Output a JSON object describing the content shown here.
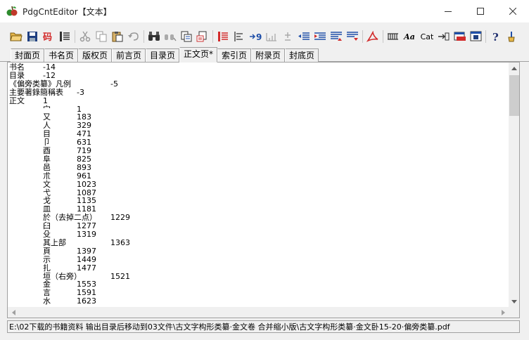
{
  "window": {
    "title": "PdgCntEditor【文本】",
    "controls": {
      "minimize": "minimize",
      "maximize": "maximize",
      "close": "close"
    }
  },
  "toolbar": {
    "font_label": "Aa",
    "cat_label": "Cat",
    "icons": [
      "open-folder-icon",
      "save-icon",
      "encoding-icon",
      "page-list-icon",
      "cut-icon",
      "copy-icon",
      "paste-icon",
      "undo-icon",
      "find-icon",
      "replace-icon",
      "page-copy-icon",
      "page-paste-icon",
      "indent-list-icon",
      "align-left-icon",
      "level-down-icon",
      "level-up-icon",
      "plus-minus-icon",
      "outdent-icon",
      "indent-icon",
      "move-up-icon",
      "move-down-icon",
      "pdf-icon",
      "columns-icon",
      "font-icon",
      "cat-icon",
      "bookmark-icon",
      "window-icon",
      "save-window-icon",
      "help-icon",
      "tools-icon"
    ]
  },
  "tabs": [
    {
      "label": "封面页",
      "active": false
    },
    {
      "label": "书名页",
      "active": false
    },
    {
      "label": "版权页",
      "active": false
    },
    {
      "label": "前言页",
      "active": false
    },
    {
      "label": "目录页",
      "active": false
    },
    {
      "label": "正文页*",
      "active": true
    },
    {
      "label": "索引页",
      "active": false
    },
    {
      "label": "附录页",
      "active": false
    },
    {
      "label": "封底页",
      "active": false
    }
  ],
  "editor": {
    "lines": [
      {
        "indent": 0,
        "title": "书名",
        "page": "-14"
      },
      {
        "indent": 0,
        "title": "目录",
        "page": "-12"
      },
      {
        "indent": 0,
        "title": "《偏旁类纂》凡例",
        "page": "-5"
      },
      {
        "indent": 0,
        "title": "主要著錄簡稱表",
        "page": "-3"
      },
      {
        "indent": 0,
        "title": "正文",
        "page": "1"
      },
      {
        "indent": 1,
        "title": "宀",
        "page": "1"
      },
      {
        "indent": 1,
        "title": "又",
        "page": "183"
      },
      {
        "indent": 1,
        "title": "人",
        "page": "329"
      },
      {
        "indent": 1,
        "title": "目",
        "page": "471"
      },
      {
        "indent": 1,
        "title": "卩",
        "page": "631"
      },
      {
        "indent": 1,
        "title": "酉",
        "page": "719"
      },
      {
        "indent": 1,
        "title": "阜",
        "page": "825"
      },
      {
        "indent": 1,
        "title": "邑",
        "page": "893"
      },
      {
        "indent": 1,
        "title": "朮",
        "page": "961"
      },
      {
        "indent": 1,
        "title": "文",
        "page": "1023"
      },
      {
        "indent": 1,
        "title": "弋",
        "page": "1087"
      },
      {
        "indent": 1,
        "title": "戈",
        "page": "1135"
      },
      {
        "indent": 1,
        "title": "皿",
        "page": "1181"
      },
      {
        "indent": 1,
        "title": "於（去掉二点）",
        "page": "1229"
      },
      {
        "indent": 1,
        "title": "臼",
        "page": "1277"
      },
      {
        "indent": 1,
        "title": "殳",
        "page": "1319"
      },
      {
        "indent": 1,
        "title": "其上部",
        "page": "1363"
      },
      {
        "indent": 1,
        "title": "頁",
        "page": "1397"
      },
      {
        "indent": 1,
        "title": "示",
        "page": "1449"
      },
      {
        "indent": 1,
        "title": "扎",
        "page": "1477"
      },
      {
        "indent": 1,
        "title": "垣（右旁）",
        "page": "1521"
      },
      {
        "indent": 1,
        "title": "金",
        "page": "1553"
      },
      {
        "indent": 1,
        "title": "言",
        "page": "1591"
      },
      {
        "indent": 1,
        "title": "水",
        "page": "1623"
      }
    ]
  },
  "status": {
    "path": "E:\\02下载的书籍资料  输出目录后移动到03文件\\古文字构形类纂·金文卷 合并缩小版\\古文字构形类纂·金文卧15-20·偏旁类纂.pdf"
  },
  "colors": {
    "toolbar_red": "#d22a2a",
    "toolbar_blue": "#1f4fa8",
    "thumb": "#cdcdcd"
  }
}
